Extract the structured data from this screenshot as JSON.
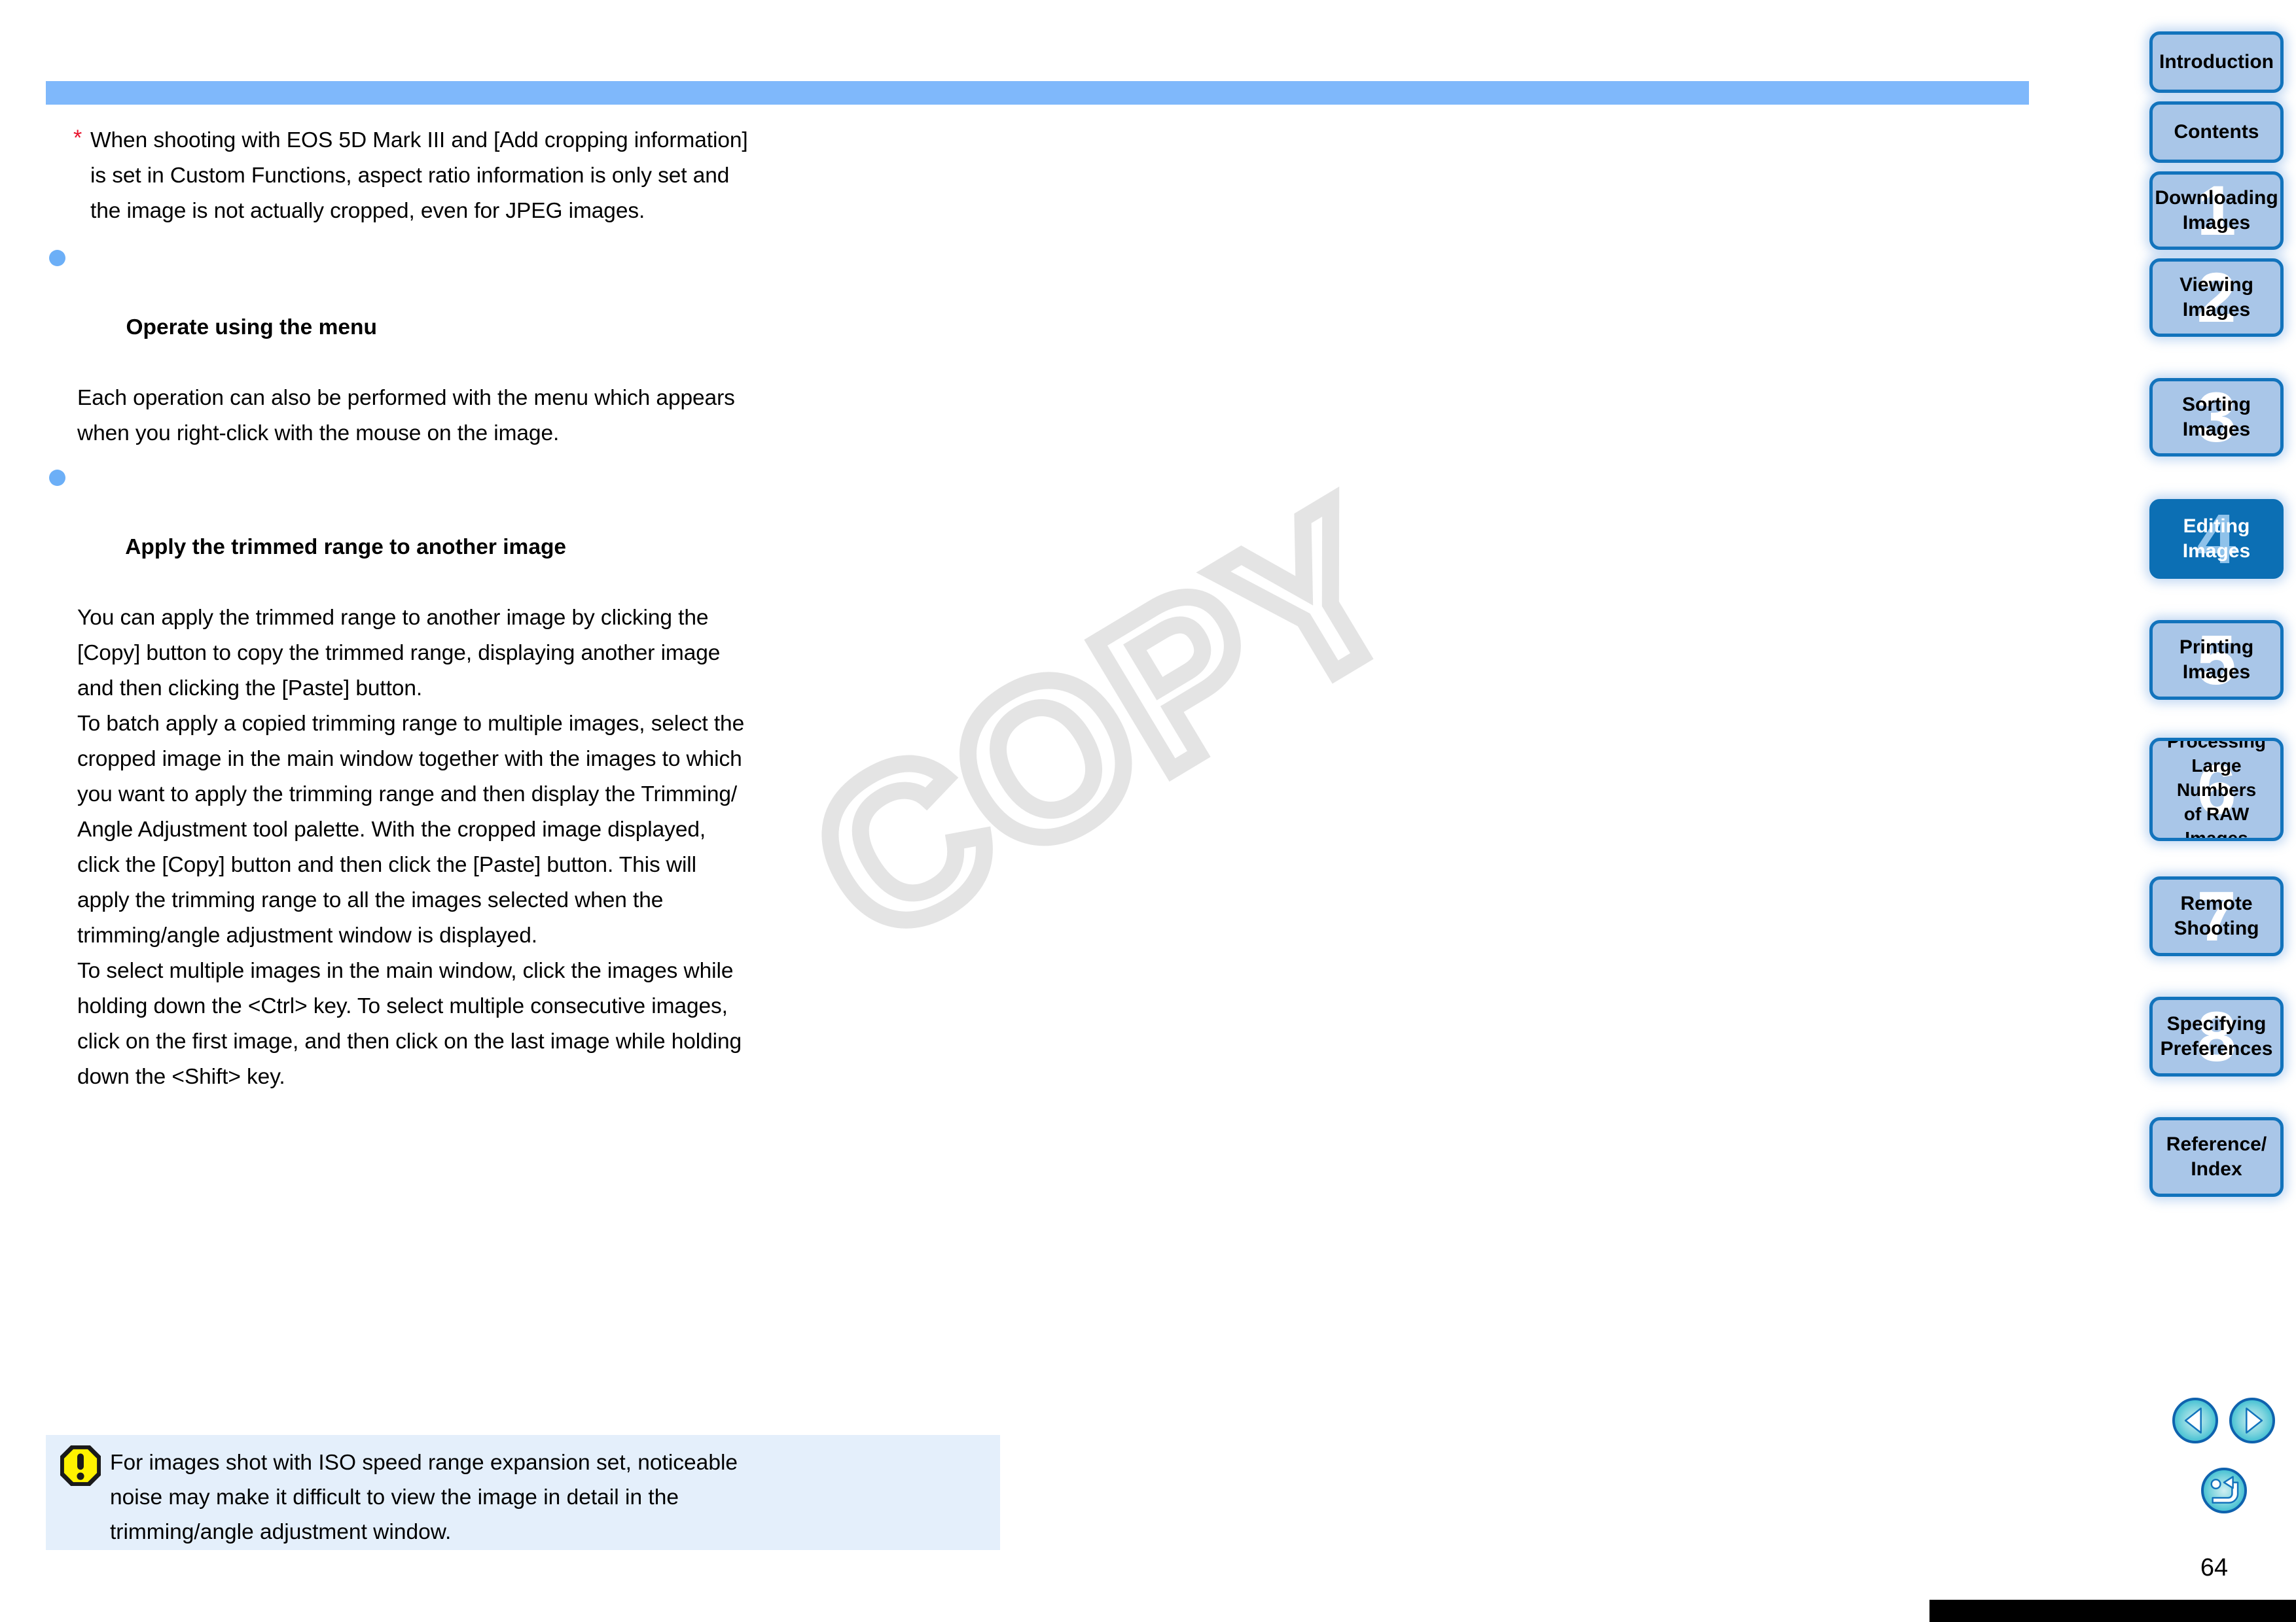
{
  "page": {
    "number": "64",
    "watermark": "COPY"
  },
  "colors": {
    "header_bar": "#7FB8FB",
    "bullet": "#6CAFF7",
    "star": "#E8142D",
    "tab_fill": "#A9C6E8",
    "tab_border": "#1273BC",
    "tab_active_fill": "#0C6FB4",
    "note_box_bg": "#E4EFFB",
    "warning_yellow": "#FFF200",
    "nav_button": "#2BB7CE"
  },
  "content": {
    "footnote": {
      "marker": "*",
      "lines": [
        "When shooting with EOS 5D Mark III and [Add cropping information]",
        "is set in Custom Functions, aspect ratio information is only set and",
        "the image is not actually cropped, even for JPEG images."
      ]
    },
    "sections": [
      {
        "heading": "Operate using the menu",
        "lines": [
          "Each operation can also be performed with the menu which appears",
          "when you right-click with the mouse on the image."
        ]
      },
      {
        "heading": "Apply the trimmed range to another image",
        "lines": [
          "You can apply the trimmed range to another image by clicking the",
          "[Copy] button to copy the trimmed range, displaying another image",
          "and then clicking the [Paste] button.",
          "To batch apply a copied trimming range to multiple images, select the",
          "cropped image in the main window together with the images to which",
          "you want to apply the trimming range and then display the Trimming/",
          "Angle Adjustment tool palette. With the cropped image displayed,",
          "click the [Copy] button and then click the [Paste] button. This will",
          "apply the trimming range to all the images selected when the",
          "trimming/angle adjustment window is displayed.",
          "To select multiple images in the main window, click the images while",
          "holding down the <Ctrl> key. To select multiple consecutive images,",
          "click on the first image, and then click on the last image while holding",
          "down the <Shift> key."
        ]
      }
    ],
    "note_box": {
      "icon": "warning-octagon-icon",
      "lines": [
        "For images shot with ISO speed range expansion set, noticeable",
        "noise may make it difficult to view the image in detail in the",
        "trimming/angle adjustment window."
      ]
    }
  },
  "sidebar": {
    "tabs": [
      {
        "label": "Introduction",
        "number": "",
        "active": false
      },
      {
        "label": "Contents",
        "number": "",
        "active": false
      },
      {
        "label": "Downloading\nImages",
        "number": "1",
        "active": false
      },
      {
        "label": "Viewing\nImages",
        "number": "2",
        "active": false
      },
      {
        "label": "Sorting\nImages",
        "number": "3",
        "active": false
      },
      {
        "label": "Editing\nImages",
        "number": "4",
        "active": true
      },
      {
        "label": "Printing\nImages",
        "number": "5",
        "active": false
      },
      {
        "label": "Processing\nLarge Numbers\nof RAW Images",
        "number": "6",
        "active": false
      },
      {
        "label": "Remote\nShooting",
        "number": "7",
        "active": false
      },
      {
        "label": "Specifying\nPreferences",
        "number": "8",
        "active": false
      },
      {
        "label": "Reference/\nIndex",
        "number": "",
        "active": false
      }
    ],
    "nav": {
      "prev": "previous-page-button",
      "next": "next-page-button",
      "back": "return-button"
    }
  }
}
